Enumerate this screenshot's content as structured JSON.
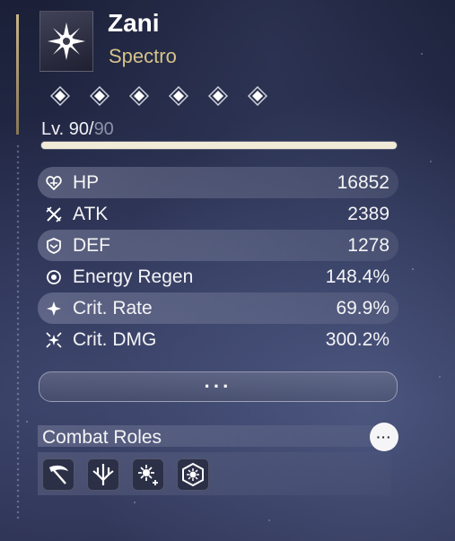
{
  "character": {
    "name": "Zani",
    "element": "Spectro",
    "element_icon": "spectro-icon"
  },
  "sequence": {
    "nodes": 6,
    "icon": "diamond-icon"
  },
  "level": {
    "current": "Lv. 90/",
    "max": "90",
    "progress": 1.0
  },
  "stats": [
    {
      "icon": "hp-icon",
      "label": "HP",
      "value": "16852"
    },
    {
      "icon": "atk-icon",
      "label": "ATK",
      "value": "2389"
    },
    {
      "icon": "def-icon",
      "label": "DEF",
      "value": "1278"
    },
    {
      "icon": "energy-regen-icon",
      "label": "Energy Regen",
      "value": "148.4%"
    },
    {
      "icon": "crit-rate-icon",
      "label": "Crit. Rate",
      "value": "69.9%"
    },
    {
      "icon": "crit-dmg-icon",
      "label": "Crit. DMG",
      "value": "300.2%"
    }
  ],
  "more_button": {
    "label": "···"
  },
  "combat_roles": {
    "title": "Combat Roles",
    "more_label": "···",
    "roles": [
      "scythe-icon",
      "trident-icon",
      "spectro-buff-icon",
      "hexagon-spectro-icon"
    ]
  },
  "colors": {
    "element": "#d6c28a",
    "accent": "#c9b48a",
    "text": "#f4f4f6"
  }
}
